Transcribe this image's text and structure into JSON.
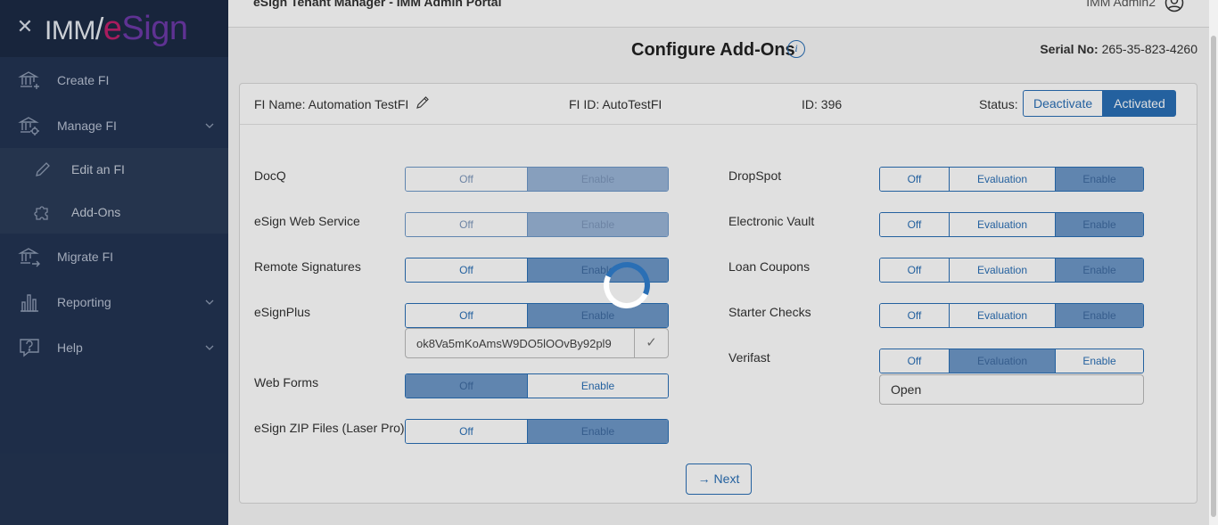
{
  "sidebar": {
    "logo": {
      "imm": "IMM",
      "slash": "/",
      "e": "e",
      "sign": "Sign"
    },
    "items": [
      {
        "label": "Create FI"
      },
      {
        "label": "Manage FI"
      },
      {
        "label": "Edit an FI"
      },
      {
        "label": "Add-Ons"
      },
      {
        "label": "Migrate FI"
      },
      {
        "label": "Reporting"
      },
      {
        "label": "Help"
      }
    ]
  },
  "topbar": {
    "title": "eSign Tenant Manager - IMM Admin Portal",
    "user": "IMM Admin2"
  },
  "page": {
    "title": "Configure Add-Ons",
    "serial_label": "Serial No:",
    "serial_value": "265-35-823-4260"
  },
  "card": {
    "fi_name": "FI Name: Automation TestFI",
    "fi_id": "FI ID: AutoTestFI",
    "id": "ID: 396",
    "status_label": "Status:",
    "status_options": [
      "Deactivate",
      "Activated"
    ],
    "status_selected": "Activated"
  },
  "addons_left": [
    {
      "name": "DocQ",
      "options": [
        "Off",
        "Enable"
      ],
      "selected": "Enable"
    },
    {
      "name": "eSign Web Service",
      "options": [
        "Off",
        "Enable"
      ],
      "selected": "Enable"
    },
    {
      "name": "Remote Signatures",
      "options": [
        "Off",
        "Enable"
      ],
      "selected": "Enable"
    },
    {
      "name": "eSignPlus",
      "options": [
        "Off",
        "Enable"
      ],
      "selected": "Enable",
      "key_value": "ok8Va5mKoAmsW9DO5lOOvBy92pl9"
    },
    {
      "name": "Web Forms",
      "options": [
        "Off",
        "Enable"
      ],
      "selected": "Off"
    },
    {
      "name": "eSign ZIP Files (Laser Pro)",
      "options": [
        "Off",
        "Enable"
      ],
      "selected": "Enable"
    }
  ],
  "addons_right": [
    {
      "name": "DropSpot",
      "options": [
        "Off",
        "Evaluation",
        "Enable"
      ],
      "selected": "Enable"
    },
    {
      "name": "Electronic Vault",
      "options": [
        "Off",
        "Evaluation",
        "Enable"
      ],
      "selected": "Enable"
    },
    {
      "name": "Loan Coupons",
      "options": [
        "Off",
        "Evaluation",
        "Enable"
      ],
      "selected": "Enable"
    },
    {
      "name": "Starter Checks",
      "options": [
        "Off",
        "Evaluation",
        "Enable"
      ],
      "selected": "Enable"
    },
    {
      "name": "Verifast",
      "options": [
        "Off",
        "Evaluation",
        "Enable"
      ],
      "selected": "Evaluation",
      "field_value": "Open"
    }
  ],
  "next_label": "→ Next",
  "key_check": "✓",
  "close_glyph": "✕",
  "info_glyph": "i",
  "colors": {
    "accent": "#2a6fb5",
    "sidebar": "#233452",
    "selected": "#9ab6d8"
  }
}
